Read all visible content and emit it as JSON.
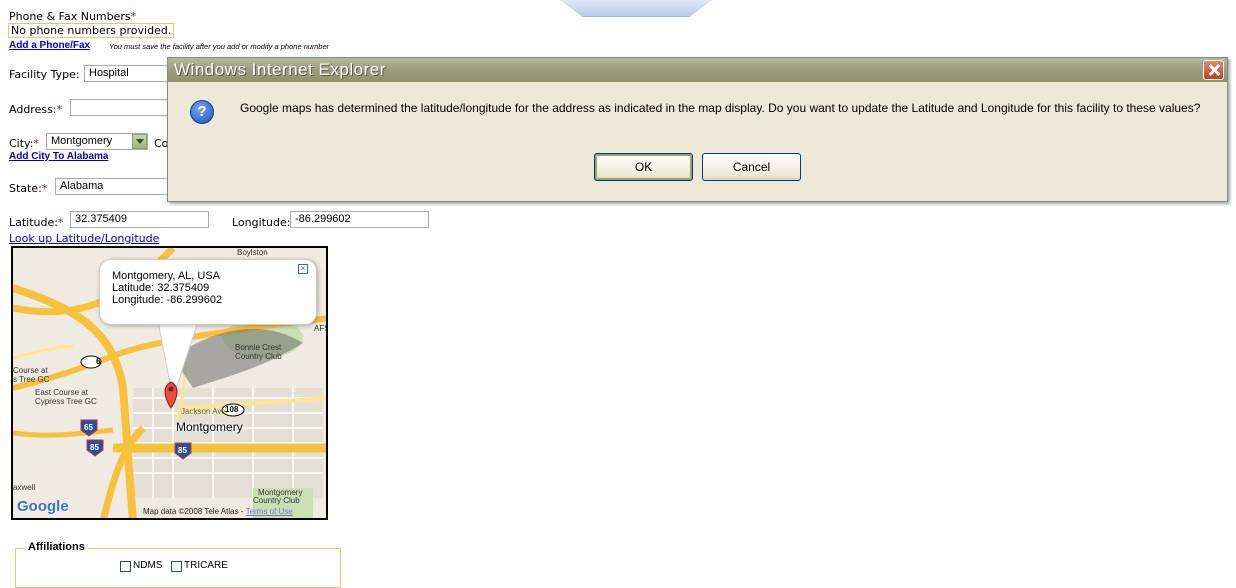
{
  "form": {
    "phone_label": "Phone & Fax Numbers",
    "required_mark": "*",
    "no_phone": "No phone numbers provided.",
    "add_phone": "Add a Phone/Fax",
    "save_note": "You must save the facility after you add or modify a phone number",
    "facility_type_label": "Facility Type:",
    "facility_type_value": "Hospital",
    "address_label": "Address:",
    "address_value": "",
    "city_label": "City:",
    "city_value": "Montgomery",
    "city_next_label": "Co",
    "add_city": "Add City To Alabama",
    "state_label": "State:",
    "state_value": "Alabama",
    "latitude_label": "Latitude:",
    "latitude_value": "32.375409",
    "longitude_label": "Longitude:",
    "longitude_value": "-86.299602",
    "lookup_link": "Look up Latitude/Longitude"
  },
  "map": {
    "callout_line1": "Montgomery, AL, USA",
    "callout_line2": "Latitude: 32.375409",
    "callout_line3": "Longitude: -86.299602",
    "city_label": "Montgomery",
    "attribution": "Map data ©2008 Tele Atlas -",
    "terms": "Terms of Use",
    "google_logo": "Google",
    "labels": {
      "course_at": "Course at",
      "tree_gc": "s Tree GC",
      "east_course": "East Course at",
      "cypress": "Cypress Tree GC",
      "bonnie": "Bonnie Crest",
      "country_club": "Country Club",
      "afs": "AFS",
      "mgm_cc": "Montgomery",
      "mgm_cc2": "Country Club",
      "boylston": "Boylston",
      "jackson_ave": "Jackson Ave",
      "maxwell": "axwell",
      "rt6": "6",
      "rt108": "108",
      "i65": "65",
      "i85": "85"
    }
  },
  "dialog": {
    "title": "Windows Internet Explorer",
    "message": "Google maps has determined the latitude/longitude for the address as indicated in the map display.  Do you want to update the Latitude and Longitude for this facility to these values?",
    "ok_label": "OK",
    "cancel_label": "Cancel",
    "icon_glyph": "?"
  },
  "affiliations": {
    "legend": "Affiliations",
    "options": [
      "NDMS",
      "TRICARE"
    ]
  }
}
